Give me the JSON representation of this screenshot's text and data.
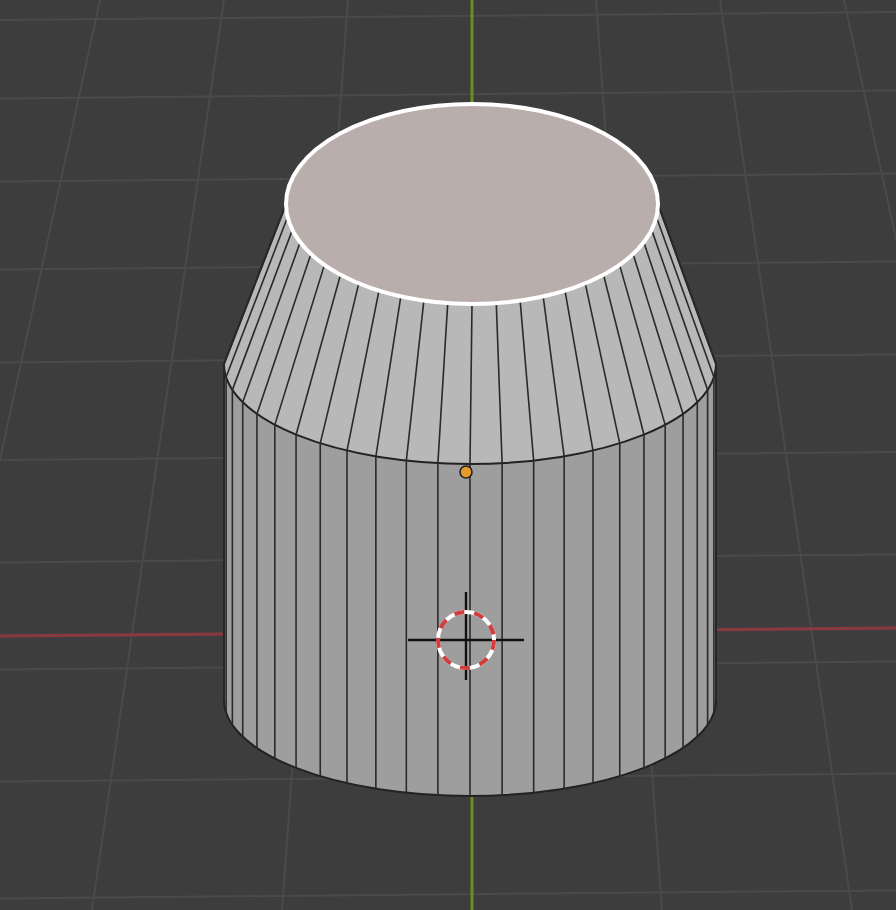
{
  "viewport": {
    "object": {
      "top_face_selected": true
    }
  }
}
